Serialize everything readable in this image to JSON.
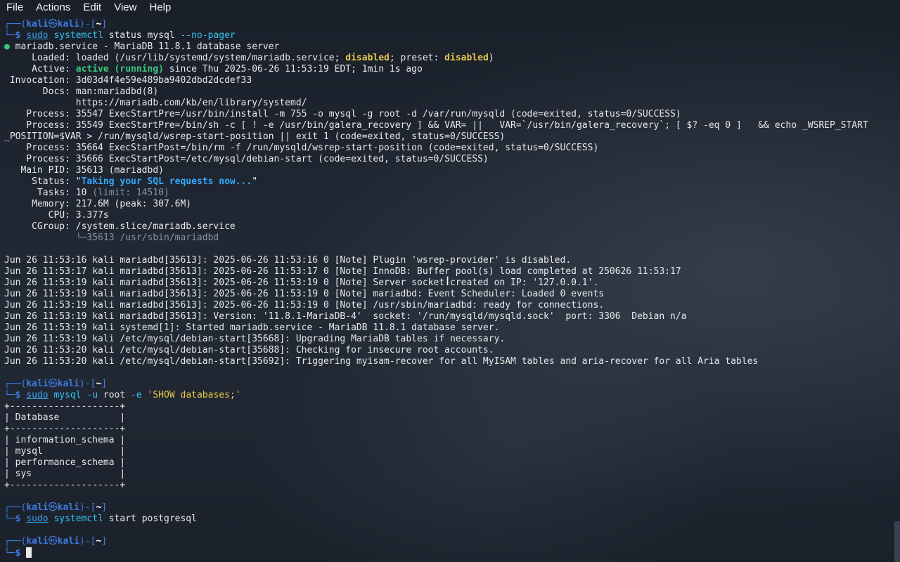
{
  "menubar": {
    "items": [
      "File",
      "Actions",
      "Edit",
      "View",
      "Help"
    ]
  },
  "prompt": {
    "open": "┌──(",
    "user": "kali",
    "at": "㉿",
    "host": "kali",
    "mid": ")-[",
    "dir": "~",
    "close": "]",
    "bottom": "└─",
    "dollar": "$"
  },
  "commands": [
    {
      "sudo": "sudo",
      "name": "systemctl",
      "args": " status mysql ",
      "flag": "--no-pager"
    },
    {
      "sudo": "sudo",
      "name": "mysql",
      "args1": " ",
      "flag1": "-u",
      "args2": " root ",
      "flag2": "-e",
      "args3": " ",
      "str": "'SHOW databases;'"
    },
    {
      "sudo": "sudo",
      "name": "systemctl",
      "args": " start postgresql"
    }
  ],
  "status_block": {
    "l1_dot": "●",
    "l1": " mariadb.service - MariaDB 11.8.1 database server",
    "l2a": "     Loaded: loaded (/usr/lib/systemd/system/mariadb.service; ",
    "l2b": "disabled",
    "l2c": "; preset: ",
    "l2d": "disabled",
    "l2e": ")",
    "l3a": "     Active: ",
    "l3b": "active (running)",
    "l3c": " since Thu 2025-06-26 11:53:19 EDT; 1min 1s ago",
    "l4": " Invocation: 3d03d4f4e59e489ba9402dbd2dcdef33",
    "l5": "       Docs: man:mariadbd(8)",
    "l6": "             https://mariadb.com/kb/en/library/systemd/",
    "l7": "    Process: 35547 ExecStartPre=/usr/bin/install -m 755 -o mysql -g root -d /var/run/mysqld (code=exited, status=0/SUCCESS)",
    "l8": "    Process: 35549 ExecStartPre=/bin/sh -c [ ! -e /usr/bin/galera_recovery ] && VAR= ||   VAR=`/usr/bin/galera_recovery`; [ $? -eq 0 ]   && echo _WSREP_START",
    "l9": "_POSITION=$VAR > /run/mysqld/wsrep-start-position || exit 1 (code=exited, status=0/SUCCESS)",
    "l10": "    Process: 35664 ExecStartPost=/bin/rm -f /run/mysqld/wsrep-start-position (code=exited, status=0/SUCCESS)",
    "l11": "    Process: 35666 ExecStartPost=/etc/mysql/debian-start (code=exited, status=0/SUCCESS)",
    "l12": "   Main PID: 35613 (mariadbd)",
    "l13a": "     Status: ",
    "l13q": "\"",
    "l13b": "Taking your SQL requests now...",
    "l13c": "\"",
    "l14a": "      Tasks: 10 ",
    "l14b": "(limit: 14510)",
    "l15": "     Memory: 217.6M (peak: 307.6M)",
    "l16": "        CPU: 3.377s",
    "l17": "     CGroup: /system.slice/mariadb.service",
    "l18": "             └─35613 /usr/sbin/mariadbd"
  },
  "journal": [
    "Jun 26 11:53:16 kali mariadbd[35613]: 2025-06-26 11:53:16 0 [Note] Plugin 'wsrep-provider' is disabled.",
    "Jun 26 11:53:17 kali mariadbd[35613]: 2025-06-26 11:53:17 0 [Note] InnoDB: Buffer pool(s) load completed at 250626 11:53:17",
    "Jun 26 11:53:19 kali mariadbd[35613]: 2025-06-26 11:53:19 0 [Note] Server socket created on IP: '127.0.0.1'.",
    "Jun 26 11:53:19 kali mariadbd[35613]: 2025-06-26 11:53:19 0 [Note] mariadbd: Event Scheduler: Loaded 0 events",
    "Jun 26 11:53:19 kali mariadbd[35613]: 2025-06-26 11:53:19 0 [Note] /usr/sbin/mariadbd: ready for connections.",
    "Jun 26 11:53:19 kali mariadbd[35613]: Version: '11.8.1-MariaDB-4'  socket: '/run/mysqld/mysqld.sock'  port: 3306  Debian n/a",
    "Jun 26 11:53:19 kali systemd[1]: Started mariadb.service - MariaDB 11.8.1 database server.",
    "Jun 26 11:53:19 kali /etc/mysql/debian-start[35668]: Upgrading MariaDB tables if necessary.",
    "Jun 26 11:53:20 kali /etc/mysql/debian-start[35688]: Checking for insecure root accounts.",
    "Jun 26 11:53:20 kali /etc/mysql/debian-start[35692]: Triggering myisam-recover for all MyISAM tables and aria-recover for all Aria tables"
  ],
  "db_table": {
    "border": "+--------------------+",
    "header": "| Database           |",
    "rows": [
      "| information_schema |",
      "| mysql              |",
      "| performance_schema |",
      "| sys                |"
    ]
  },
  "colors": {
    "prompt": "#3d7be0",
    "command": "#33c4f0",
    "string": "#e6c64a",
    "active": "#3bc77a"
  }
}
